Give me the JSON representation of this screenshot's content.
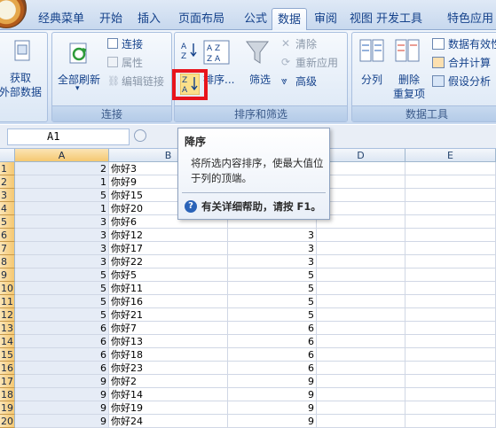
{
  "tabs": [
    "经典菜单",
    "开始",
    "插入",
    "页面布局",
    "公式",
    "数据",
    "审阅",
    "视图",
    "开发工具",
    "特色应用"
  ],
  "active_tab": "数据",
  "ribbon": {
    "get_external": [
      "获取",
      "外部数据"
    ],
    "connections": {
      "refresh_all": "全部刷新",
      "connect": "连接",
      "properties": "属性",
      "edit_links": "编辑链接",
      "group_label": "连接"
    },
    "sort_filter": {
      "sort_label": "排序...",
      "filter_label": "筛选",
      "clear": "清除",
      "reapply": "重新应用",
      "advanced": "高级",
      "group_label": "排序和筛选"
    },
    "data_tools": {
      "text_to_columns": "分列",
      "remove_dup": [
        "删除",
        "重复项"
      ],
      "data_validation": "数据有效性",
      "consolidate": "合并计算",
      "what_if": "假设分析",
      "group_label": "数据工具"
    }
  },
  "name_box": "A1",
  "tooltip": {
    "title": "降序",
    "body": "将所选内容排序，使最大值位于列的顶端。",
    "help": "有关详细帮助，请按 F1。"
  },
  "columns": [
    "A",
    "B",
    "C",
    "D",
    "E"
  ],
  "rows": [
    {
      "n": "1",
      "a": "2",
      "b": "你好3",
      "c": ""
    },
    {
      "n": "2",
      "a": "1",
      "b": "你好9",
      "c": ""
    },
    {
      "n": "3",
      "a": "5",
      "b": "你好15",
      "c": ""
    },
    {
      "n": "4",
      "a": "1",
      "b": "你好20",
      "c": ""
    },
    {
      "n": "5",
      "a": "3",
      "b": "你好6",
      "c": ""
    },
    {
      "n": "6",
      "a": "3",
      "b": "你好12",
      "c": "3"
    },
    {
      "n": "7",
      "a": "3",
      "b": "你好17",
      "c": "3"
    },
    {
      "n": "8",
      "a": "3",
      "b": "你好22",
      "c": "3"
    },
    {
      "n": "9",
      "a": "5",
      "b": "你好5",
      "c": "5"
    },
    {
      "n": "10",
      "a": "5",
      "b": "你好11",
      "c": "5"
    },
    {
      "n": "11",
      "a": "5",
      "b": "你好16",
      "c": "5"
    },
    {
      "n": "12",
      "a": "5",
      "b": "你好21",
      "c": "5"
    },
    {
      "n": "13",
      "a": "6",
      "b": "你好7",
      "c": "6"
    },
    {
      "n": "14",
      "a": "6",
      "b": "你好13",
      "c": "6"
    },
    {
      "n": "15",
      "a": "6",
      "b": "你好18",
      "c": "6"
    },
    {
      "n": "16",
      "a": "6",
      "b": "你好23",
      "c": "6"
    },
    {
      "n": "17",
      "a": "9",
      "b": "你好2",
      "c": "9"
    },
    {
      "n": "18",
      "a": "9",
      "b": "你好14",
      "c": "9"
    },
    {
      "n": "19",
      "a": "9",
      "b": "你好19",
      "c": "9"
    },
    {
      "n": "20",
      "a": "9",
      "b": "你好24",
      "c": "9"
    }
  ],
  "colors": {
    "highlight": "#e8141c",
    "ribbon_text": "#15428b",
    "selection": "#f5c871"
  }
}
